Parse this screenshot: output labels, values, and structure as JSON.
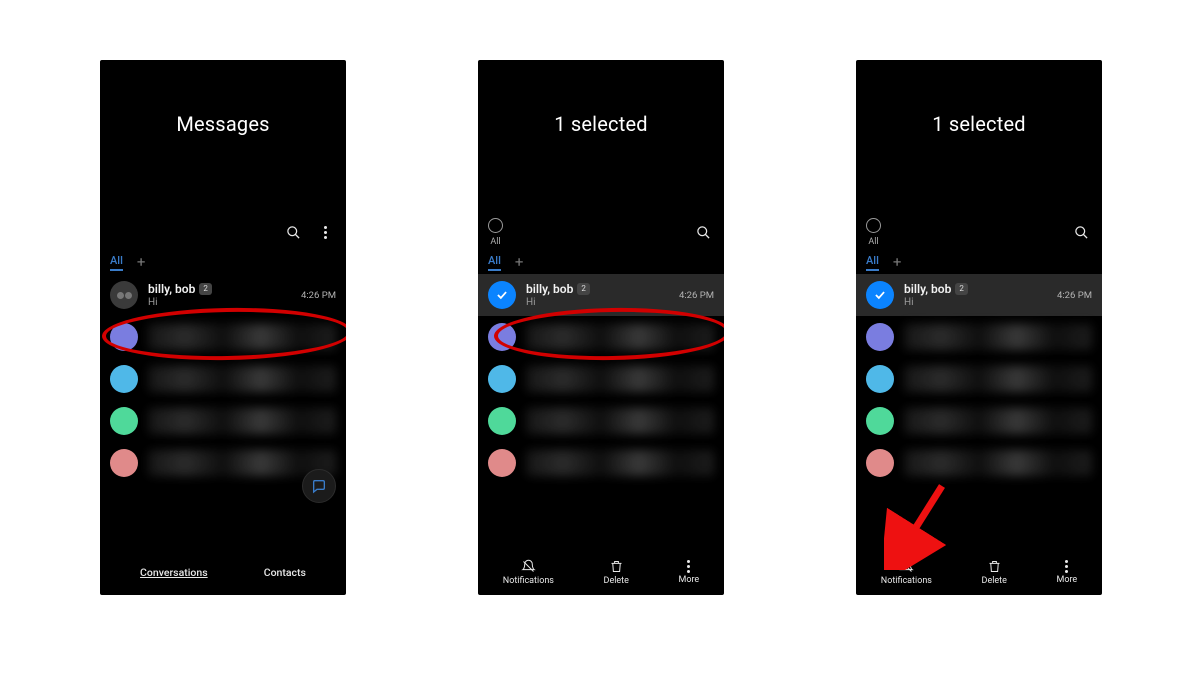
{
  "screens": [
    {
      "title": "Messages",
      "mode": "normal",
      "tabs": {
        "all": "All"
      },
      "conversation": {
        "name": "billy, bob",
        "badge": "2",
        "preview": "Hi",
        "time": "4:26 PM"
      },
      "bottom": {
        "conversations": "Conversations",
        "contacts": "Contacts"
      }
    },
    {
      "title": "1 selected",
      "mode": "selection",
      "all_label": "All",
      "tabs": {
        "all": "All"
      },
      "conversation": {
        "name": "billy, bob",
        "badge": "2",
        "preview": "Hi",
        "time": "4:26 PM"
      },
      "bottom": {
        "notifications": "Notifications",
        "delete": "Delete",
        "more": "More"
      }
    },
    {
      "title": "1 selected",
      "mode": "selection",
      "all_label": "All",
      "tabs": {
        "all": "All"
      },
      "conversation": {
        "name": "billy, bob",
        "badge": "2",
        "preview": "Hi",
        "time": "4:26 PM"
      },
      "bottom": {
        "notifications": "Notifications",
        "delete": "Delete",
        "more": "More"
      }
    }
  ],
  "colors": {
    "accent": "#0b84ff",
    "annotation": "#d20000"
  }
}
